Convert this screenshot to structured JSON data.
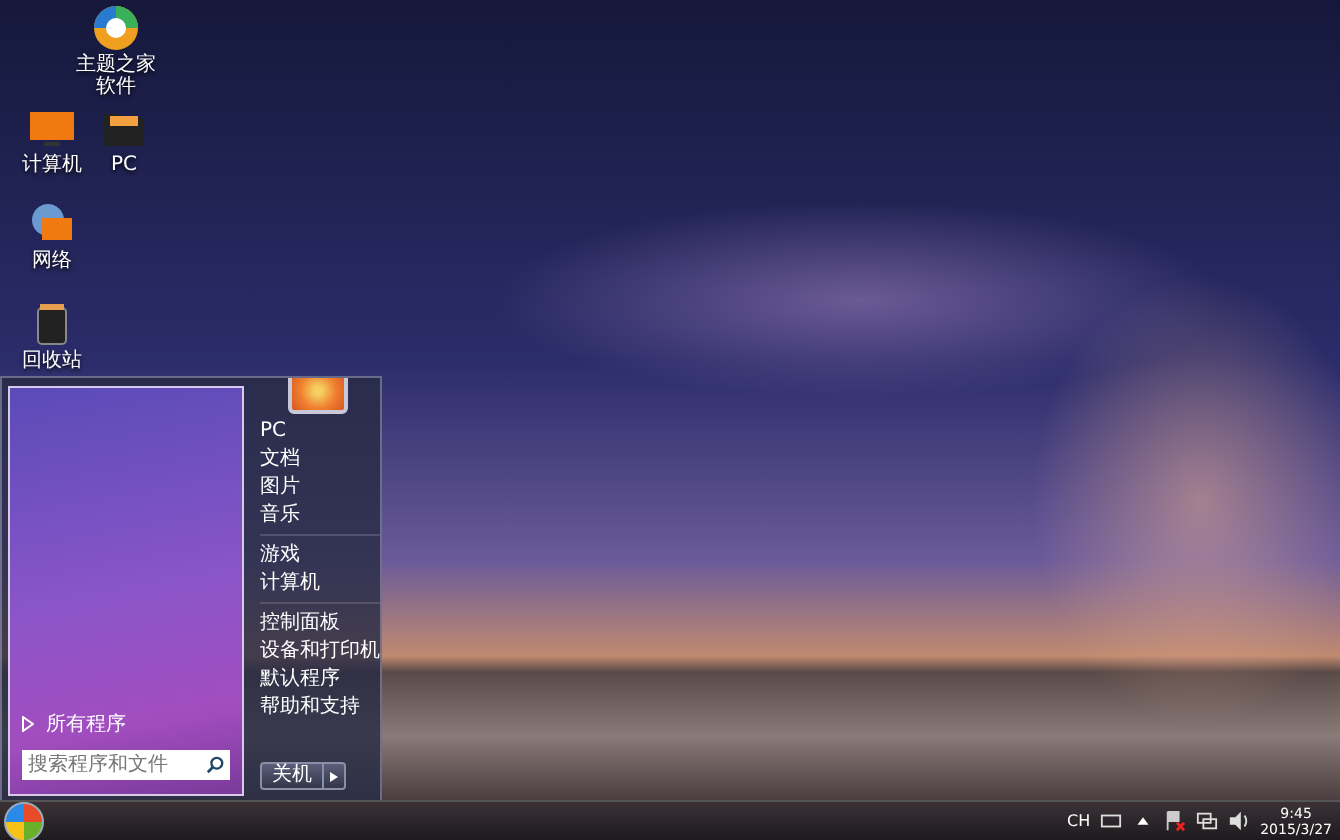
{
  "desktop_icons": [
    {
      "label": "主题之家软件",
      "kind": "app"
    },
    {
      "label": "计算机",
      "kind": "monitor"
    },
    {
      "label": "PC",
      "kind": "folder"
    },
    {
      "label": "网络",
      "kind": "network"
    },
    {
      "label": "回收站",
      "kind": "bin"
    }
  ],
  "start_menu": {
    "all_programs": "所有程序",
    "search": {
      "placeholder": "搜索程序和文件"
    },
    "item_groups": [
      [
        "PC",
        "文档",
        "图片",
        "音乐"
      ],
      [
        "游戏",
        "计算机"
      ],
      [
        "控制面板",
        "设备和打印机",
        "默认程序",
        "帮助和支持"
      ]
    ],
    "shutdown": "关机"
  },
  "taskbar": {
    "language": "CH",
    "time": "9:45",
    "date": "2015/3/27"
  }
}
